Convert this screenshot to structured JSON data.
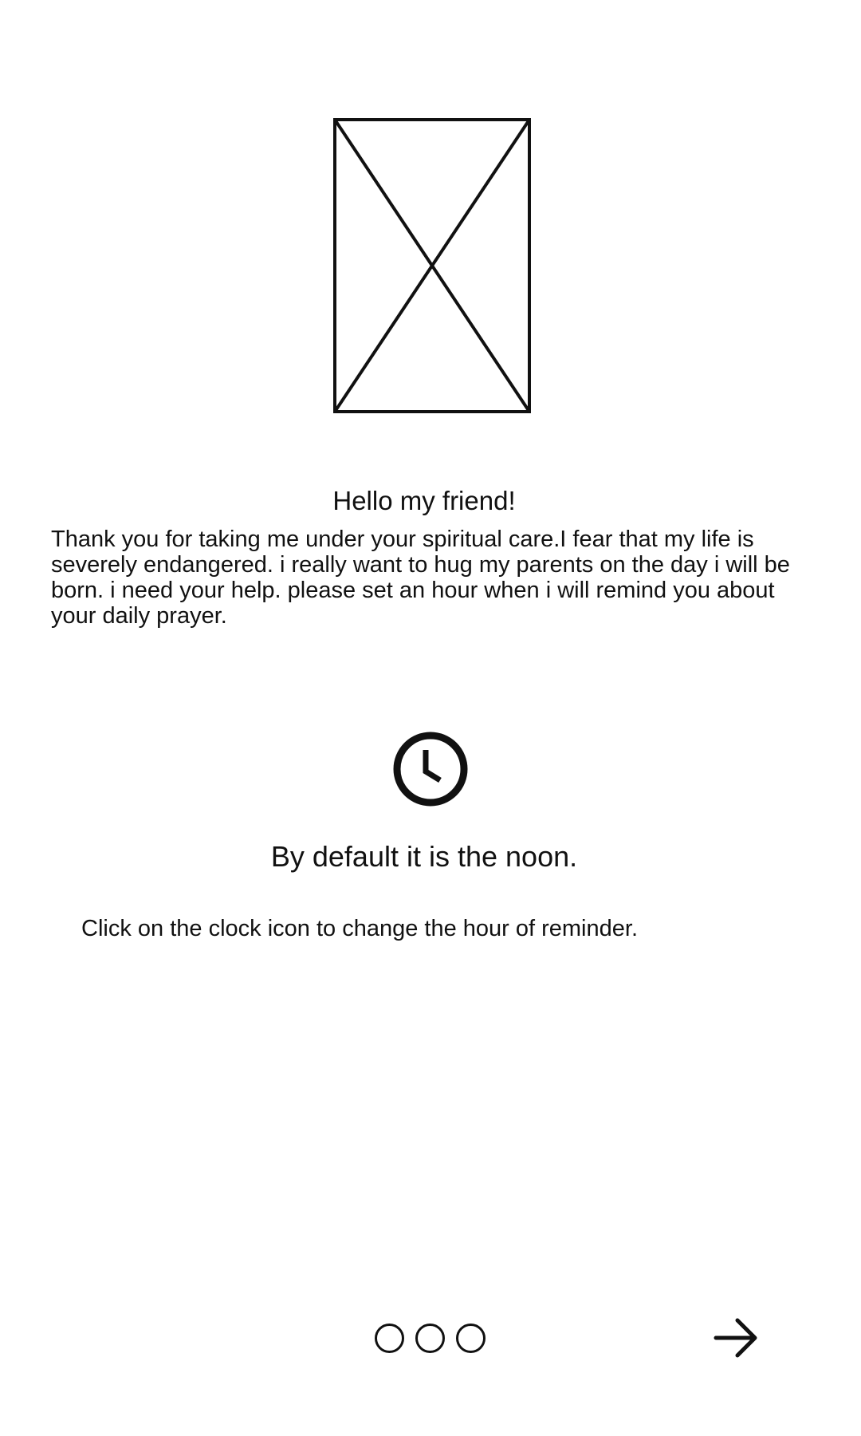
{
  "onboarding": {
    "greeting": "Hello my friend!",
    "message": "Thank you for taking me under your spiritual care.I fear that my life is severely endangered. i really want to hug my parents on the day i will be born. i need your help. please set an hour when i will remind you about your daily prayer.",
    "default_note": "By default it is the noon.",
    "hint": "Click on the clock icon to change the hour of reminder."
  },
  "icons": {
    "image": "image-placeholder-icon",
    "clock": "clock-icon",
    "next": "arrow-right-icon"
  },
  "pager": {
    "total_pages": 3
  },
  "colors": {
    "background": "#ffffff",
    "ink": "#111111"
  }
}
